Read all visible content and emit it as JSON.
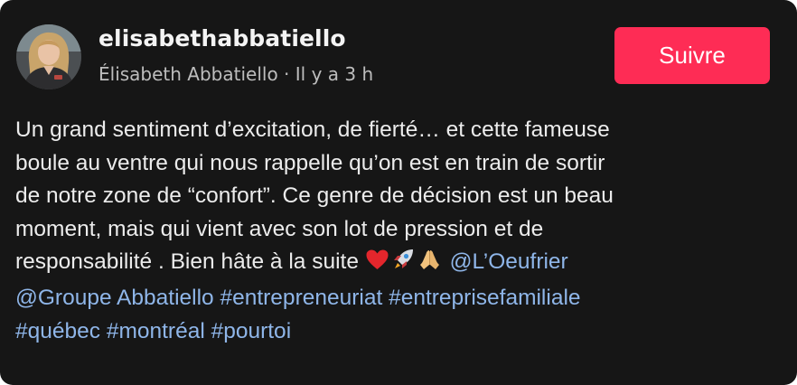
{
  "post": {
    "username": "elisabethabbatiello",
    "display_name": "Élisabeth Abbatiello",
    "separator": " · ",
    "time_ago": "Il y a 3 h",
    "follow_label": "Suivre"
  },
  "caption": {
    "line1": "Un grand sentiment d’excitation, de fierté… et cette fameuse",
    "line2": "boule au ventre qui nous rappelle qu’on est en train de sortir",
    "line3": "de notre zone de “confort”. Ce genre de décision est un beau",
    "line4": "moment, mais qui vient avec son lot de pression et de",
    "line5_text": "responsabilité . Bien hâte à la suite ",
    "emojis": [
      "heart-emoji",
      "rocket-emoji",
      "folded-hands-emoji"
    ],
    "mention1": "@L’Oeufrier",
    "mention2": "@Groupe Abbatiello",
    "hashtag1": "#entrepreneuriat",
    "hashtag2": "#entreprisefamiliale",
    "hashtag3": "#québec",
    "hashtag4": "#montréal",
    "hashtag5": "#pourtoi"
  },
  "colors": {
    "background": "#161616",
    "accent": "#fe2c55",
    "link": "#8fb6e9"
  }
}
